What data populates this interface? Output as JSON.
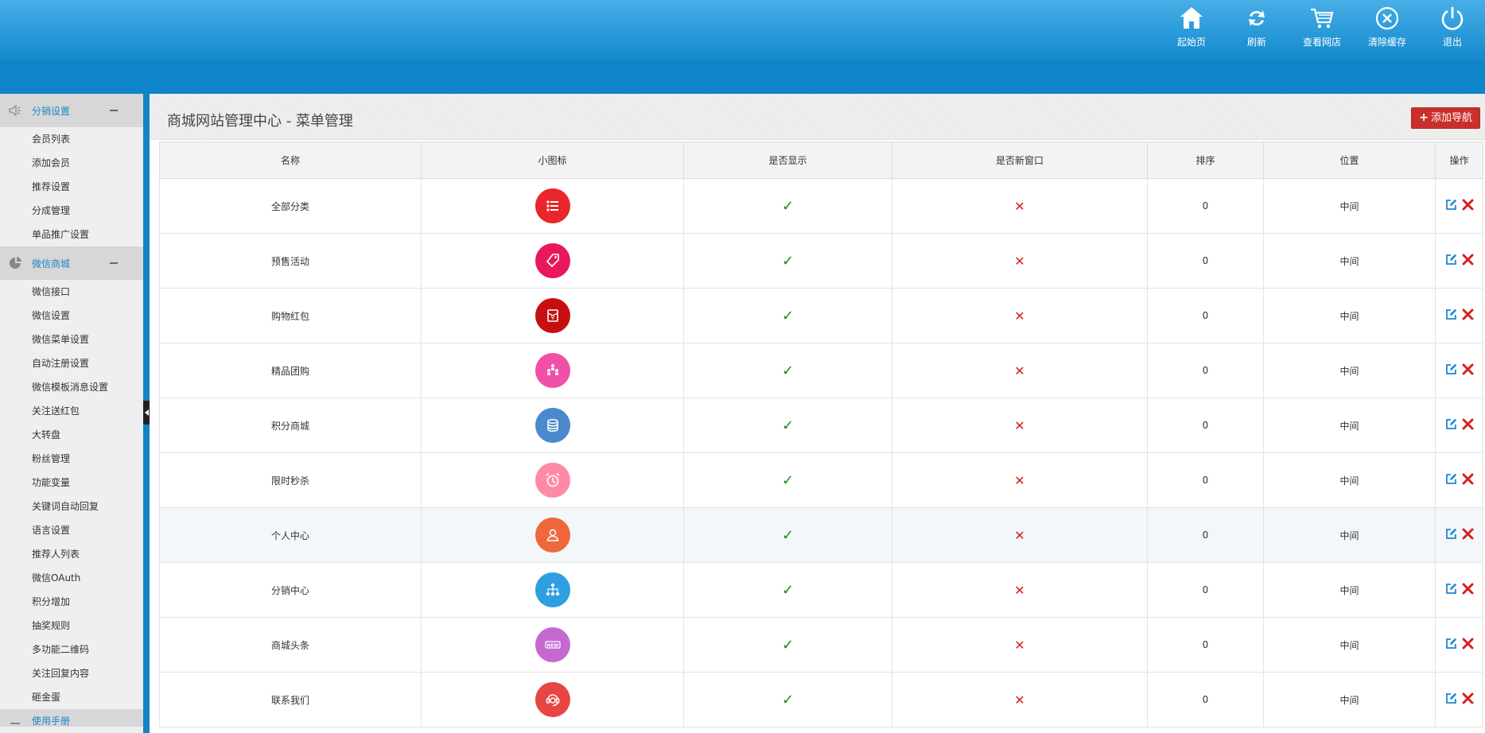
{
  "header": {
    "actions": [
      {
        "label": "起始页",
        "icon": "home-icon"
      },
      {
        "label": "刷新",
        "icon": "refresh-icon"
      },
      {
        "label": "查看网店",
        "icon": "cart-icon"
      },
      {
        "label": "清除缓存",
        "icon": "clear-cache-icon"
      },
      {
        "label": "退出",
        "icon": "power-icon"
      }
    ]
  },
  "sidebar": {
    "groups": [
      {
        "label": "分销设置",
        "icon": "speaker-icon",
        "items": [
          "会员列表",
          "添加会员",
          "推荐设置",
          "分成管理",
          "单品推广设置"
        ]
      },
      {
        "label": "微信商城",
        "icon": "pie-chart-icon",
        "items": [
          "微信接口",
          "微信设置",
          "微信菜单设置",
          "自动注册设置",
          "微信模板消息设置",
          "关注送红包",
          "大转盘",
          "粉丝管理",
          "功能变量",
          "关键词自动回复",
          "语言设置",
          "推荐人列表",
          "微信OAuth",
          "积分增加",
          "抽奖规则",
          "多功能二维码",
          "关注回复内容",
          "砸金蛋"
        ]
      },
      {
        "label": "使用手册",
        "icon": "book-icon",
        "items": []
      }
    ]
  },
  "main": {
    "title": "商城网站管理中心 - 菜单管理",
    "add_button": "添加导航",
    "columns": [
      "名称",
      "小图标",
      "是否显示",
      "是否新窗口",
      "排序",
      "位置",
      "操作"
    ],
    "rows": [
      {
        "name": "全部分类",
        "icon": "list-icon",
        "color": "#e8262b",
        "show": "✓",
        "new_window": "✕",
        "order": "0",
        "position": "中间"
      },
      {
        "name": "预售活动",
        "icon": "tag-icon",
        "color": "#e8185a",
        "show": "✓",
        "new_window": "✕",
        "order": "0",
        "position": "中间"
      },
      {
        "name": "购物红包",
        "icon": "red-packet-icon",
        "color": "#c70f12",
        "show": "✓",
        "new_window": "✕",
        "order": "0",
        "position": "中间"
      },
      {
        "name": "精品团购",
        "icon": "group-icon",
        "color": "#f24fa6",
        "show": "✓",
        "new_window": "✕",
        "order": "0",
        "position": "中间"
      },
      {
        "name": "积分商城",
        "icon": "coins-icon",
        "color": "#4a89cc",
        "show": "✓",
        "new_window": "✕",
        "order": "0",
        "position": "中间"
      },
      {
        "name": "限时秒杀",
        "icon": "alarm-clock-icon",
        "color": "#ff8aa8",
        "show": "✓",
        "new_window": "✕",
        "order": "0",
        "position": "中间"
      },
      {
        "name": "个人中心",
        "icon": "user-icon",
        "color": "#f0673e",
        "show": "✓",
        "new_window": "✕",
        "order": "0",
        "position": "中间"
      },
      {
        "name": "分销中心",
        "icon": "hierarchy-icon",
        "color": "#2e9fe0",
        "show": "✓",
        "new_window": "✕",
        "order": "0",
        "position": "中间"
      },
      {
        "name": "商城头条",
        "icon": "new-badge-icon",
        "color": "#c569d1",
        "show": "✓",
        "new_window": "✕",
        "order": "0",
        "position": "中间"
      },
      {
        "name": "联系我们",
        "icon": "customer-service-icon",
        "color": "#e84545",
        "show": "✓",
        "new_window": "✕",
        "order": "0",
        "position": "中间"
      }
    ]
  }
}
